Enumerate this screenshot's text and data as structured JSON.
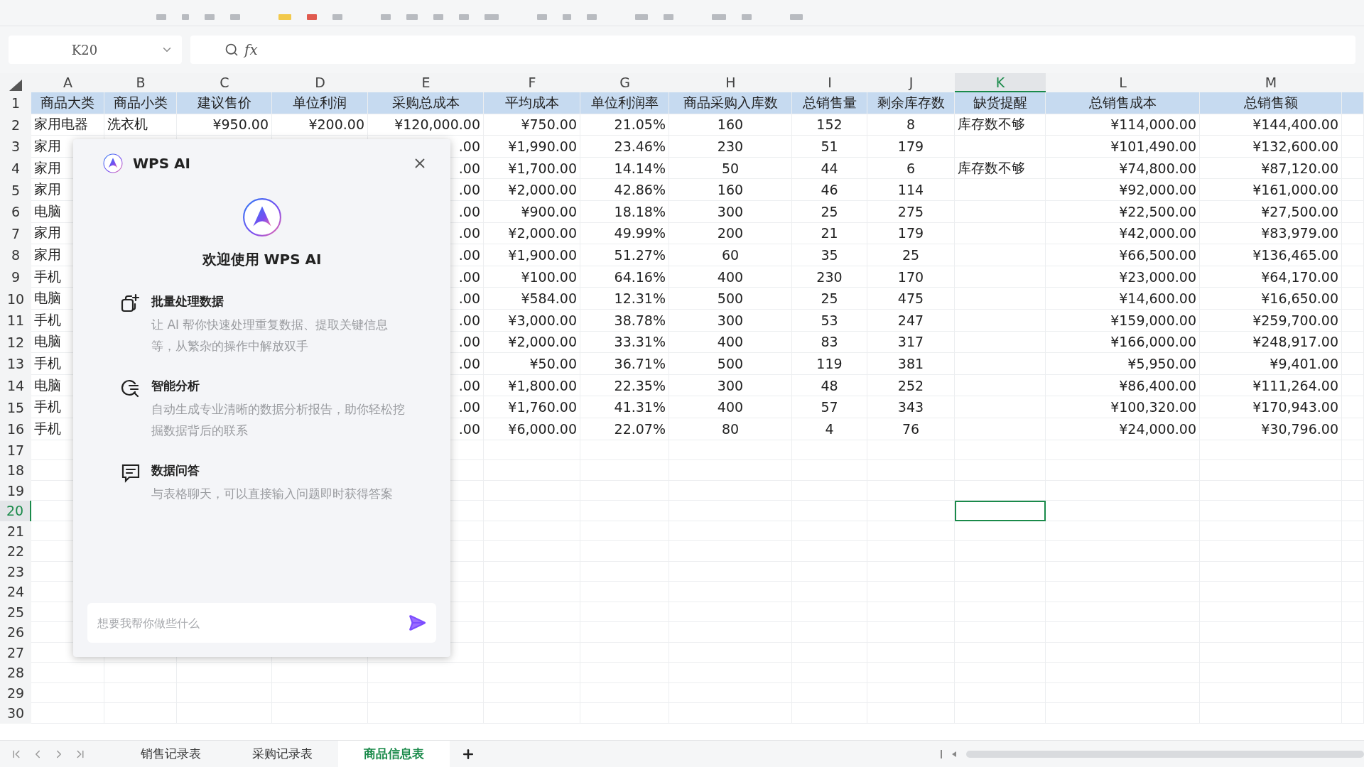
{
  "formula_bar": {
    "cell_ref": "K20",
    "function_label": "fx"
  },
  "sheet": {
    "columns": [
      {
        "letter": "A",
        "selected": false
      },
      {
        "letter": "B",
        "selected": false
      },
      {
        "letter": "C",
        "selected": false
      },
      {
        "letter": "D",
        "selected": false
      },
      {
        "letter": "E",
        "selected": false
      },
      {
        "letter": "F",
        "selected": false
      },
      {
        "letter": "G",
        "selected": false
      },
      {
        "letter": "H",
        "selected": false
      },
      {
        "letter": "I",
        "selected": false
      },
      {
        "letter": "J",
        "selected": false
      },
      {
        "letter": "K",
        "selected": true
      },
      {
        "letter": "L",
        "selected": false
      },
      {
        "letter": "M",
        "selected": false
      }
    ],
    "rows": [
      {
        "number": "1",
        "selected": false,
        "header": true,
        "cells": [
          "商品大类",
          "商品小类",
          "建议售价",
          "单位利润",
          "采购总成本",
          "平均成本",
          "单位利润率",
          "商品采购入库数",
          "总销售量",
          "剩余库存数",
          "缺货提醒",
          "总销售成本",
          "总销售额"
        ]
      },
      {
        "number": "2",
        "selected": false,
        "cells": [
          "家用电器",
          "洗衣机",
          "¥950.00",
          "¥200.00",
          "¥120,000.00",
          "¥750.00",
          "21.05%",
          "160",
          "152",
          "8",
          "库存数不够",
          "¥114,000.00",
          "¥144,400.00"
        ]
      },
      {
        "number": "3",
        "selected": false,
        "cells": [
          "家用",
          null,
          null,
          null,
          ".00",
          "¥1,990.00",
          "23.46%",
          "230",
          "51",
          "179",
          null,
          "¥101,490.00",
          "¥132,600.00"
        ]
      },
      {
        "number": "4",
        "selected": false,
        "cells": [
          "家用",
          null,
          null,
          null,
          ".00",
          "¥1,700.00",
          "14.14%",
          "50",
          "44",
          "6",
          "库存数不够",
          "¥74,800.00",
          "¥87,120.00"
        ]
      },
      {
        "number": "5",
        "selected": false,
        "cells": [
          "家用",
          null,
          null,
          null,
          ".00",
          "¥2,000.00",
          "42.86%",
          "160",
          "46",
          "114",
          null,
          "¥92,000.00",
          "¥161,000.00"
        ]
      },
      {
        "number": "6",
        "selected": false,
        "cells": [
          "电脑",
          null,
          null,
          null,
          ".00",
          "¥900.00",
          "18.18%",
          "300",
          "25",
          "275",
          null,
          "¥22,500.00",
          "¥27,500.00"
        ]
      },
      {
        "number": "7",
        "selected": false,
        "cells": [
          "家用",
          null,
          null,
          null,
          ".00",
          "¥2,000.00",
          "49.99%",
          "200",
          "21",
          "179",
          null,
          "¥42,000.00",
          "¥83,979.00"
        ]
      },
      {
        "number": "8",
        "selected": false,
        "cells": [
          "家用",
          null,
          null,
          null,
          ".00",
          "¥1,900.00",
          "51.27%",
          "60",
          "35",
          "25",
          null,
          "¥66,500.00",
          "¥136,465.00"
        ]
      },
      {
        "number": "9",
        "selected": false,
        "cells": [
          "手机",
          null,
          null,
          null,
          ".00",
          "¥100.00",
          "64.16%",
          "400",
          "230",
          "170",
          null,
          "¥23,000.00",
          "¥64,170.00"
        ]
      },
      {
        "number": "10",
        "selected": false,
        "cells": [
          "电脑",
          null,
          null,
          null,
          ".00",
          "¥584.00",
          "12.31%",
          "500",
          "25",
          "475",
          null,
          "¥14,600.00",
          "¥16,650.00"
        ]
      },
      {
        "number": "11",
        "selected": false,
        "cells": [
          "手机",
          null,
          null,
          null,
          ".00",
          "¥3,000.00",
          "38.78%",
          "300",
          "53",
          "247",
          null,
          "¥159,000.00",
          "¥259,700.00"
        ]
      },
      {
        "number": "12",
        "selected": false,
        "cells": [
          "电脑",
          null,
          null,
          null,
          ".00",
          "¥2,000.00",
          "33.31%",
          "400",
          "83",
          "317",
          null,
          "¥166,000.00",
          "¥248,917.00"
        ]
      },
      {
        "number": "13",
        "selected": false,
        "cells": [
          "手机",
          null,
          null,
          null,
          ".00",
          "¥50.00",
          "36.71%",
          "500",
          "119",
          "381",
          null,
          "¥5,950.00",
          "¥9,401.00"
        ]
      },
      {
        "number": "14",
        "selected": false,
        "cells": [
          "电脑",
          null,
          null,
          null,
          ".00",
          "¥1,800.00",
          "22.35%",
          "300",
          "48",
          "252",
          null,
          "¥86,400.00",
          "¥111,264.00"
        ]
      },
      {
        "number": "15",
        "selected": false,
        "cells": [
          "手机",
          null,
          null,
          null,
          ".00",
          "¥1,760.00",
          "41.31%",
          "400",
          "57",
          "343",
          null,
          "¥100,320.00",
          "¥170,943.00"
        ]
      },
      {
        "number": "16",
        "selected": false,
        "cells": [
          "手机",
          null,
          null,
          null,
          ".00",
          "¥6,000.00",
          "22.07%",
          "80",
          "4",
          "76",
          null,
          "¥24,000.00",
          "¥30,796.00"
        ]
      },
      {
        "number": "17",
        "selected": false
      },
      {
        "number": "18",
        "selected": false
      },
      {
        "number": "19",
        "selected": false
      },
      {
        "number": "20",
        "selected": true
      },
      {
        "number": "21",
        "selected": false
      },
      {
        "number": "22",
        "selected": false
      },
      {
        "number": "23",
        "selected": false
      },
      {
        "number": "24",
        "selected": false
      },
      {
        "number": "25",
        "selected": false
      },
      {
        "number": "26",
        "selected": false
      },
      {
        "number": "27",
        "selected": false
      },
      {
        "number": "28",
        "selected": false
      },
      {
        "number": "29",
        "selected": false
      },
      {
        "number": "30",
        "selected": false
      }
    ]
  },
  "ai_panel": {
    "title": "WPS AI",
    "welcome": "欢迎使用 WPS AI",
    "features": [
      {
        "kind": "batch",
        "title": "批量处理数据",
        "description": "让 AI 帮你快速处理重复数据、提取关键信息等，从繁杂的操作中解放双手"
      },
      {
        "kind": "analysis",
        "title": "智能分析",
        "description": "自动生成专业清晰的数据分析报告，助你轻松挖掘数据背后的联系"
      },
      {
        "kind": "chat",
        "title": "数据问答",
        "description": "与表格聊天，可以直接输入问题即时获得答案"
      }
    ],
    "input": {
      "placeholder": "想要我帮你做些什么"
    }
  },
  "sheet_tabs": [
    {
      "label": "销售记录表",
      "selected": false
    },
    {
      "label": "采购记录表",
      "selected": false
    },
    {
      "label": "商品信息表",
      "selected": true
    }
  ]
}
